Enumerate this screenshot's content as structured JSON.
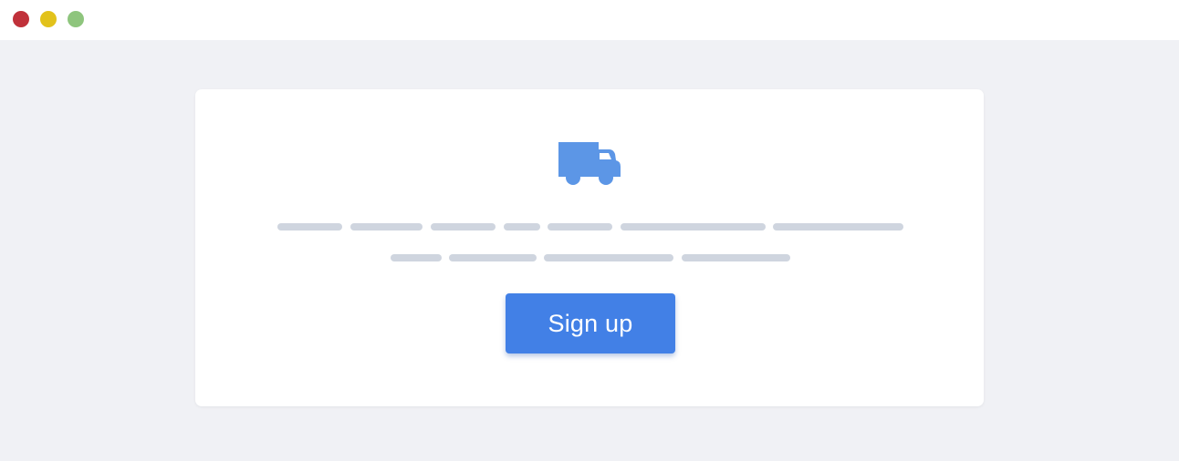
{
  "window": {
    "controls": [
      {
        "name": "close",
        "color": "#c0313a"
      },
      {
        "name": "minimize",
        "color": "#e2c21b"
      },
      {
        "name": "maximize",
        "color": "#8ec57d"
      }
    ]
  },
  "card": {
    "icon": "truck-icon",
    "icon_color": "#5c96e6",
    "placeholder_color": "#cfd5df",
    "signup_label": "Sign up",
    "button_color": "#4280e6"
  }
}
